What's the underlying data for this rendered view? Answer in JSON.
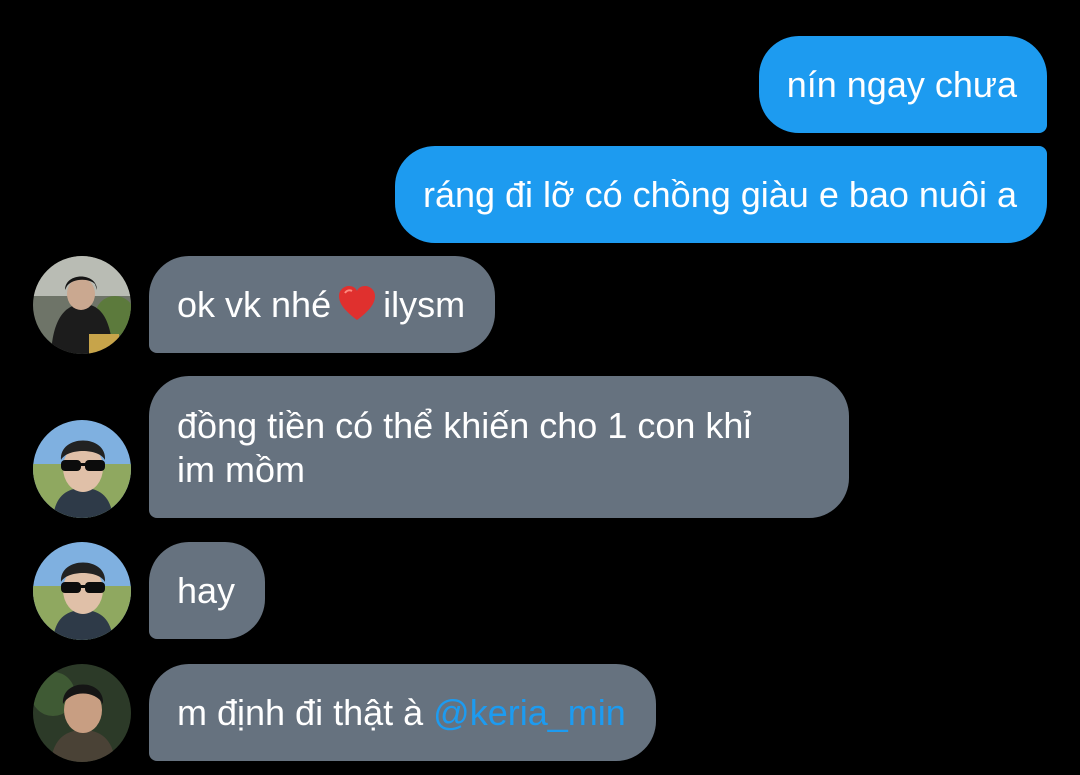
{
  "messages": [
    {
      "direction": "outgoing",
      "text": "nín ngay chưa"
    },
    {
      "direction": "outgoing",
      "text": "ráng đi lỡ có chồng giàu e bao nuôi a"
    },
    {
      "direction": "incoming",
      "avatar": "avatar-1",
      "text_before": "ok vk nhé",
      "icon": "red-heart-icon",
      "text_after": "ilysm"
    },
    {
      "direction": "incoming",
      "avatar": "avatar-2",
      "line1": "đồng tiền có thể khiến cho 1 con khỉ",
      "line2": "im mồm"
    },
    {
      "direction": "incoming",
      "avatar": "avatar-2",
      "text": "hay"
    },
    {
      "direction": "incoming",
      "avatar": "avatar-3",
      "text": "m định đi thật à",
      "mention": "@keria_min"
    }
  ],
  "colors": {
    "background": "#000000",
    "outgoing_bubble": "#1d9bf0",
    "incoming_bubble": "#66727f",
    "text": "#ffffff",
    "mention": "#1d9bf0",
    "heart": "#e0302e"
  }
}
